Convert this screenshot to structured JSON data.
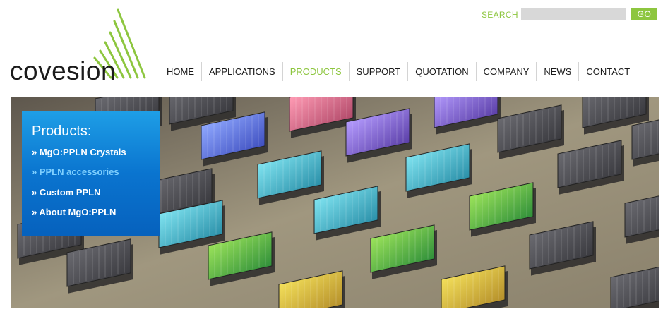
{
  "logo": {
    "text": "covesion",
    "icon": "covesion-signal-waves-logo",
    "color": "#8dc63f"
  },
  "search": {
    "label": "SEARCH",
    "placeholder": "",
    "value": "",
    "button_label": "GO"
  },
  "nav": {
    "items": [
      {
        "label": "HOME",
        "active": false
      },
      {
        "label": "APPLICATIONS",
        "active": false
      },
      {
        "label": "PRODUCTS",
        "active": true
      },
      {
        "label": "SUPPORT",
        "active": false
      },
      {
        "label": "QUOTATION",
        "active": false
      },
      {
        "label": "COMPANY",
        "active": false
      },
      {
        "label": "NEWS",
        "active": false
      },
      {
        "label": "CONTACT",
        "active": false
      }
    ]
  },
  "products_panel": {
    "title": "Products:",
    "links": [
      {
        "label": "» MgO:PPLN Crystals",
        "highlighted": false
      },
      {
        "label": "» PPLN accessories",
        "highlighted": true
      },
      {
        "label": "» Custom PPLN",
        "highlighted": false
      },
      {
        "label": "» About MgO:PPLN",
        "highlighted": false
      }
    ]
  },
  "colors": {
    "accent_green": "#8dc63f",
    "panel_blue": "#0a74cf",
    "link_highlight": "#7fd0ff"
  }
}
